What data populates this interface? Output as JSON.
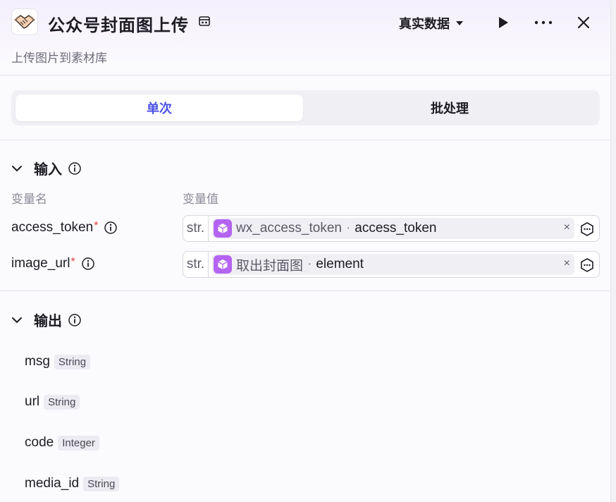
{
  "header": {
    "title": "公众号封面图上传",
    "subtitle": "上传图片到素材库",
    "mode_label": "真实数据"
  },
  "tabs": [
    {
      "label": "单次",
      "active": true
    },
    {
      "label": "批处理",
      "active": false
    }
  ],
  "input_section": {
    "title": "输入",
    "col_name": "变量名",
    "col_value": "变量值",
    "rows": [
      {
        "name": "access_token",
        "required": "*",
        "type": "str.",
        "source": "wx_access_token",
        "dot": "·",
        "field": "access_token",
        "clear": "×"
      },
      {
        "name": "image_url",
        "required": "*",
        "type": "str.",
        "source": "取出封面图",
        "dot": "·",
        "field": "element",
        "clear": "×"
      }
    ]
  },
  "output_section": {
    "title": "输出",
    "rows": [
      {
        "name": "msg",
        "type": "String"
      },
      {
        "name": "url",
        "type": "String"
      },
      {
        "name": "code",
        "type": "Integer"
      },
      {
        "name": "media_id",
        "type": "String"
      }
    ]
  },
  "colors": {
    "accent": "#4d53e8",
    "chip_icon": "#b564f2",
    "required": "#e5403f"
  }
}
